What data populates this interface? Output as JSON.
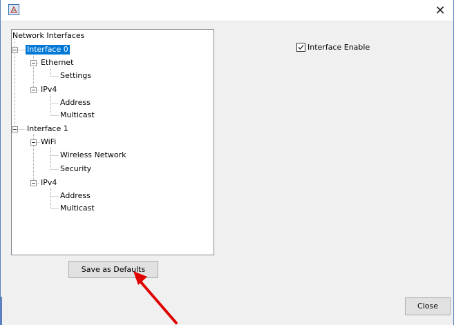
{
  "window": {
    "close_glyph": "✕"
  },
  "tree": {
    "header": "Network Interfaces",
    "nodes": [
      {
        "label": "Interface 0",
        "selected": true
      },
      {
        "label": "Ethernet"
      },
      {
        "label": "Settings"
      },
      {
        "label": "IPv4"
      },
      {
        "label": "Address"
      },
      {
        "label": "Multicast"
      },
      {
        "label": "Interface 1"
      },
      {
        "label": "WiFi"
      },
      {
        "label": "Wireless Network"
      },
      {
        "label": "Security"
      },
      {
        "label": "IPv4"
      },
      {
        "label": "Address"
      },
      {
        "label": "Multicast"
      }
    ]
  },
  "options": {
    "interface_enable_label": "Interface Enable",
    "interface_enable_checked": true
  },
  "buttons": {
    "save_defaults": "Save as Defaults",
    "close": "Close"
  },
  "colors": {
    "selection": "#0078d7",
    "annotation_arrow": "#e00000",
    "window_border": "#5b7fbf"
  }
}
